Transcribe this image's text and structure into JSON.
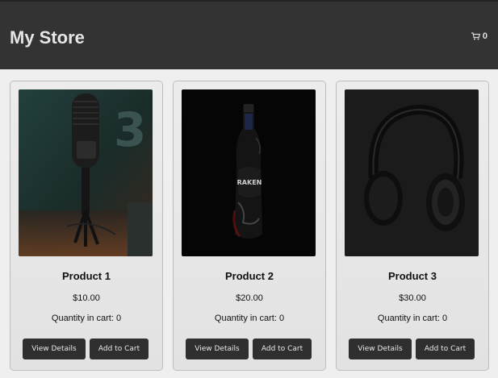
{
  "header": {
    "title": "My Store",
    "cart_count": "0",
    "cart_icon": "shopping-cart-icon"
  },
  "products": [
    {
      "name": "Product 1",
      "price": "$10.00",
      "quantity": "Quantity in cart: 0",
      "details_label": "View Details",
      "add_label": "Add to Cart",
      "image": "microphone photo"
    },
    {
      "name": "Product 2",
      "price": "$20.00",
      "quantity": "Quantity in cart: 0",
      "details_label": "View Details",
      "add_label": "Add to Cart",
      "image": "bottle photo"
    },
    {
      "name": "Product 3",
      "price": "$30.00",
      "quantity": "Quantity in cart: 0",
      "details_label": "View Details",
      "add_label": "Add to Cart",
      "image": "headphones photo"
    }
  ],
  "colors": {
    "header_bg": "#333333",
    "button_bg": "#2f2f2f",
    "page_bg": "#efefef"
  }
}
